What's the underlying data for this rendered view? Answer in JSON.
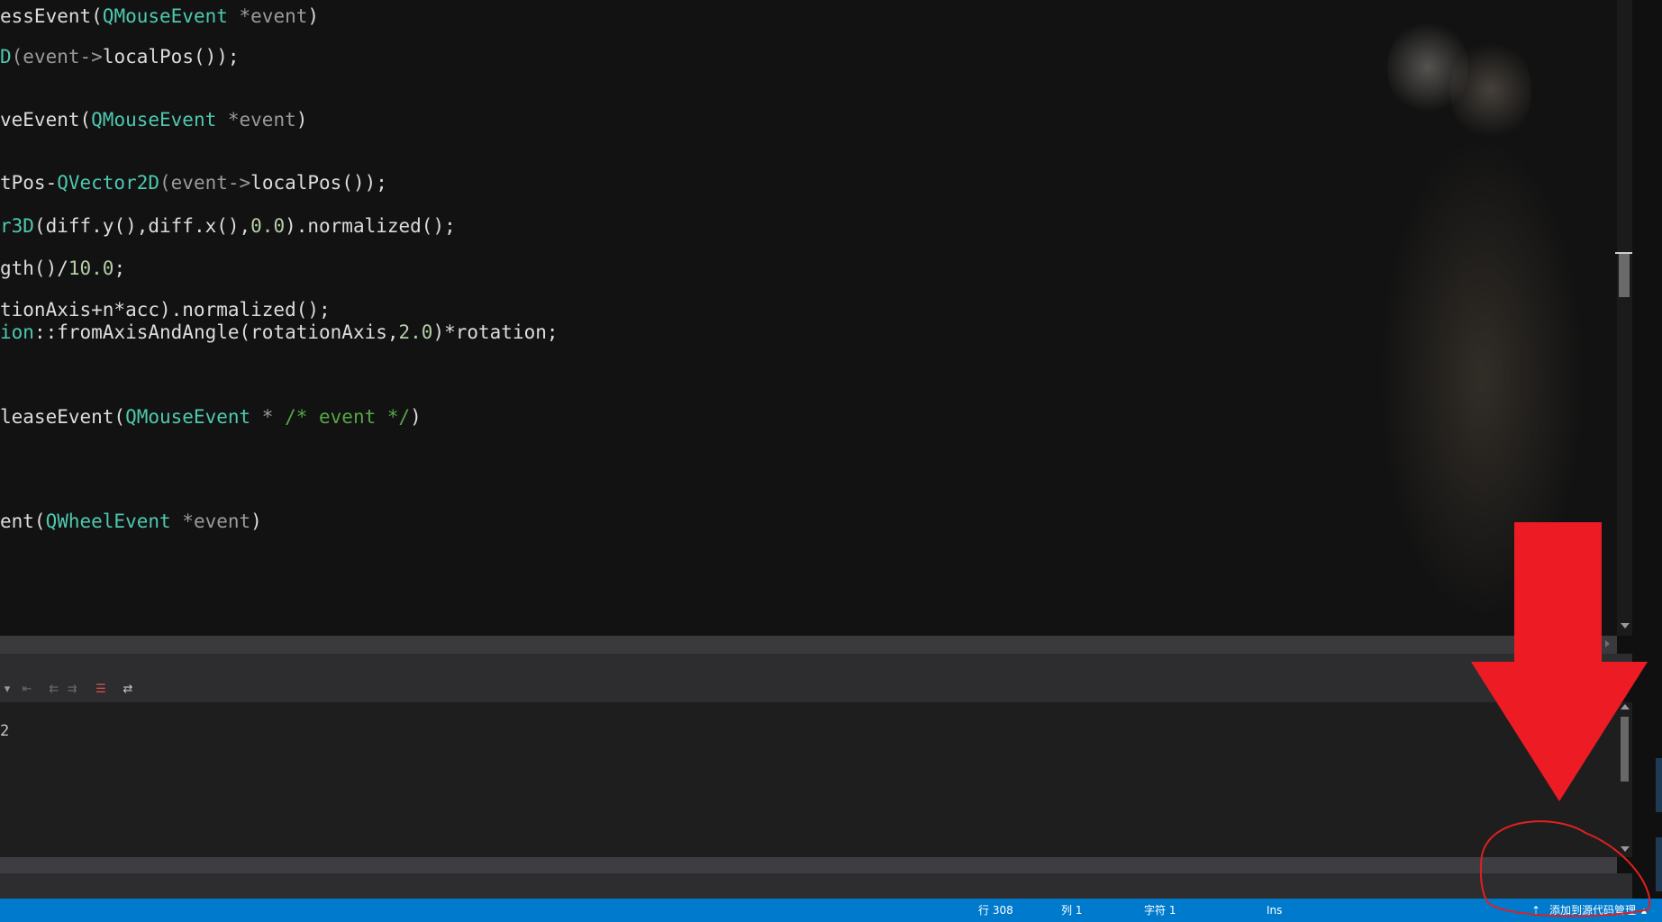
{
  "editor": {
    "lines": [
      {
        "parts": [
          {
            "t": "essEvent(",
            "c": ""
          },
          {
            "t": "QMouseEvent",
            "c": "t"
          },
          {
            "t": " *event",
            "c": "p"
          },
          {
            "t": ")",
            "c": ""
          }
        ]
      },
      {
        "parts": [
          {
            "t": "D",
            "c": "t"
          },
          {
            "t": "(event->",
            "c": "p"
          },
          {
            "t": "localPos());",
            "c": ""
          }
        ]
      },
      {
        "parts": [
          {
            "t": "veEvent(",
            "c": ""
          },
          {
            "t": "QMouseEvent",
            "c": "t"
          },
          {
            "t": " *event",
            "c": "p"
          },
          {
            "t": ")",
            "c": ""
          }
        ]
      },
      {
        "parts": [
          {
            "t": "tPos-",
            "c": ""
          },
          {
            "t": "QVector2D",
            "c": "t"
          },
          {
            "t": "(event->",
            "c": "p"
          },
          {
            "t": "localPos());",
            "c": ""
          }
        ]
      },
      {
        "parts": [
          {
            "t": "r3D",
            "c": "t"
          },
          {
            "t": "(diff.y(),diff.x(),",
            "c": ""
          },
          {
            "t": "0.0",
            "c": "n"
          },
          {
            "t": ").normalized();",
            "c": ""
          }
        ]
      },
      {
        "parts": [
          {
            "t": "gth()/",
            "c": ""
          },
          {
            "t": "10.0",
            "c": "n"
          },
          {
            "t": ";",
            "c": ""
          }
        ]
      },
      {
        "parts": [
          {
            "t": "tionAxis+n*acc).normalized();",
            "c": ""
          }
        ]
      },
      {
        "parts": [
          {
            "t": "ion",
            "c": "t"
          },
          {
            "t": "::fromAxisAndAngle(rotationAxis,",
            "c": ""
          },
          {
            "t": "2.0",
            "c": "n"
          },
          {
            "t": ")*rotation;",
            "c": ""
          }
        ]
      },
      {
        "parts": [
          {
            "t": "leaseEvent(",
            "c": ""
          },
          {
            "t": "QMouseEvent",
            "c": "t"
          },
          {
            "t": " * ",
            "c": "p"
          },
          {
            "t": "/* event */",
            "c": "c"
          },
          {
            "t": ")",
            "c": ""
          }
        ]
      },
      {
        "parts": [
          {
            "t": "ent(",
            "c": ""
          },
          {
            "t": "QWheelEvent",
            "c": "t"
          },
          {
            "t": " *event",
            "c": "p"
          },
          {
            "t": ")",
            "c": ""
          }
        ]
      }
    ]
  },
  "output": {
    "text": "2"
  },
  "status_bar": {
    "line": "行 308",
    "col": "列 1",
    "char": "字符 1",
    "mode": "Ins",
    "source_control": "添加到源代码管理"
  },
  "colors": {
    "status_bg": "#007acc",
    "annotation_red": "#ed1c24",
    "type": "#4ec9b0"
  }
}
